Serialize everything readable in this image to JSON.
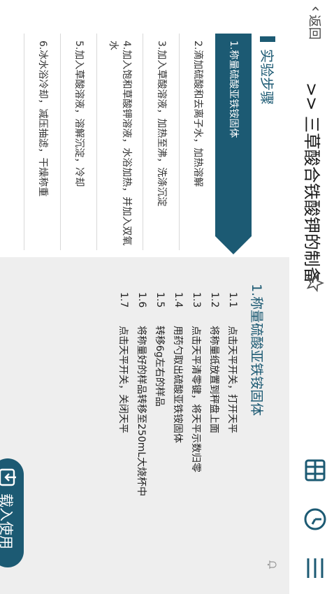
{
  "header": {
    "back_label": "返回",
    "title": ">> 三草酸合铁酸钾的制备"
  },
  "steps_section": {
    "title": "实验步骤",
    "steps": [
      {
        "label": "1.称量硫酸亚铁铵固体",
        "active": true
      },
      {
        "label": "2.滴加硫酸和去离子水，加热溶解",
        "active": false
      },
      {
        "label": "3.加入草酸溶液，加热至沸，洗涤沉淀",
        "active": false
      },
      {
        "label": "4.加入饱和草酸钾溶液，水浴加热，并加入双氧水",
        "active": false
      },
      {
        "label": "5.加入草酸溶液，溶解沉淀，冷却",
        "active": false
      },
      {
        "label": "6.冰水浴冷却，减压抽滤，干燥称重",
        "active": false
      }
    ]
  },
  "detail": {
    "title": "1.称量硫酸亚铁铵固体",
    "items": [
      {
        "num": "1.1",
        "text": "点击天平开关，打开天平"
      },
      {
        "num": "1.2",
        "text": "将称量纸放置到秤盘上面"
      },
      {
        "num": "1.3",
        "text": "点击天平清零键，将天平示数归零"
      },
      {
        "num": "1.4",
        "text": "用药勺取出硫酸亚铁铵固体"
      },
      {
        "num": "1.5",
        "text": "转移6g左右的样品"
      },
      {
        "num": "1.6",
        "text": "将称量好的样品转移至250mL大烧杯中"
      },
      {
        "num": "1.7",
        "text": "点击天平开关，关闭天平"
      }
    ]
  },
  "load_button_label": "载入使用",
  "icons": {
    "fav": "star-icon",
    "top": [
      "grid-icon",
      "clock-icon",
      "menu-icon"
    ],
    "bell": "bell-icon",
    "load": "import-icon"
  },
  "colors": {
    "accent": "#1c5a73",
    "panel": "#eeeeee"
  }
}
